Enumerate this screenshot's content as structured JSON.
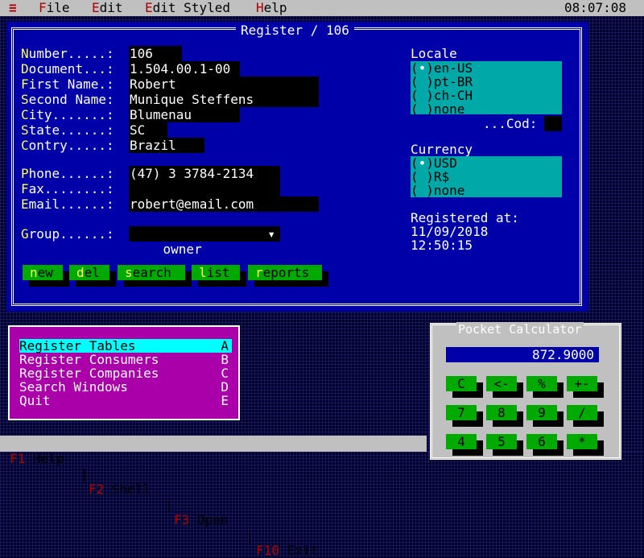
{
  "menubar": {
    "items": [
      {
        "hot": "F",
        "rest": "ile"
      },
      {
        "hot": "E",
        "rest": "dit"
      },
      {
        "hot": "E",
        "rest": "dit Styled"
      },
      {
        "hot": "H",
        "rest": "elp"
      }
    ],
    "clock": "08:07:08"
  },
  "register": {
    "title": "Register / 106",
    "fields": [
      {
        "hk": "N",
        "rest": "umber.....:",
        "value": "106"
      },
      {
        "hk": "D",
        "rest": "ocument...:",
        "value": "1.504.00.1-00"
      },
      {
        "hk": "F",
        "rest": "irst Name.:",
        "value": "Robert"
      },
      {
        "hk": "S",
        "rest": "econd Name:",
        "value": "Munique Steffens"
      },
      {
        "hk": "C",
        "rest": "ity.......:",
        "value": "Blumenau"
      },
      {
        "hk": "S",
        "rest": "tate......:",
        "value": "SC"
      },
      {
        "hk": "C",
        "rest": "ontry.....:",
        "value": "Brazil"
      },
      {
        "hk": "P",
        "rest": "hone......:",
        "value": "(47) 3 3784-2134"
      },
      {
        "hk": "F",
        "rest": "ax........:",
        "value": ""
      },
      {
        "hk": "E",
        "rest": "mail......:",
        "value": "robert@email.com"
      },
      {
        "hk": "G",
        "rest": "roup......:",
        "value": "owner"
      }
    ],
    "group_arrow": "▾",
    "locale": {
      "label": "Locale",
      "options": [
        "en-US",
        "pt-BR",
        "ch-CH",
        "none"
      ],
      "selected_index": 0,
      "cod_label": "...Cod:",
      "cod_value": ""
    },
    "currency": {
      "label": "Currency",
      "options": [
        "USD",
        "R$",
        "none"
      ],
      "selected_index": 0
    },
    "registered_label": "Registered at:",
    "registered_date": "11/09/2018",
    "registered_time": "12:50:15",
    "buttons": [
      {
        "hk": "n",
        "rest": "ew"
      },
      {
        "hk": "d",
        "rest": "el"
      },
      {
        "hk": "s",
        "rest": "earch"
      },
      {
        "hk": "l",
        "rest": "ist"
      },
      {
        "hk": "r",
        "rest": "eports"
      }
    ]
  },
  "menu": {
    "items": [
      {
        "label": "Register Tables",
        "key": "A"
      },
      {
        "label": "Register Consumers",
        "key": "B"
      },
      {
        "label": "Register Companies",
        "key": "C"
      },
      {
        "label": "Search Windows",
        "key": "D"
      },
      {
        "label": "Quit",
        "key": "E"
      }
    ],
    "active_index": 0
  },
  "calculator": {
    "title": "Pocket Calculator",
    "display": "872.9000",
    "keys": [
      [
        "C",
        "<-",
        "%",
        "+-"
      ],
      [
        "7",
        "8",
        "9",
        "/"
      ],
      [
        "4",
        "5",
        "6",
        "*"
      ]
    ]
  },
  "statusbar": [
    {
      "key": "F1",
      "label": " Help"
    },
    {
      "key": "F2",
      "label": " Shell"
    },
    {
      "key": "F3",
      "label": " Open"
    },
    {
      "key": "F10",
      "label": " Exit"
    }
  ],
  "colors": {
    "window_blue": "#0000a8",
    "menu_gray": "#c0c0c0",
    "cyan": "#00a8a8",
    "green": "#00aa00",
    "magenta": "#aa00aa",
    "hotkey_yellow": "#ffff55",
    "hotkey_red": "#b00000"
  }
}
